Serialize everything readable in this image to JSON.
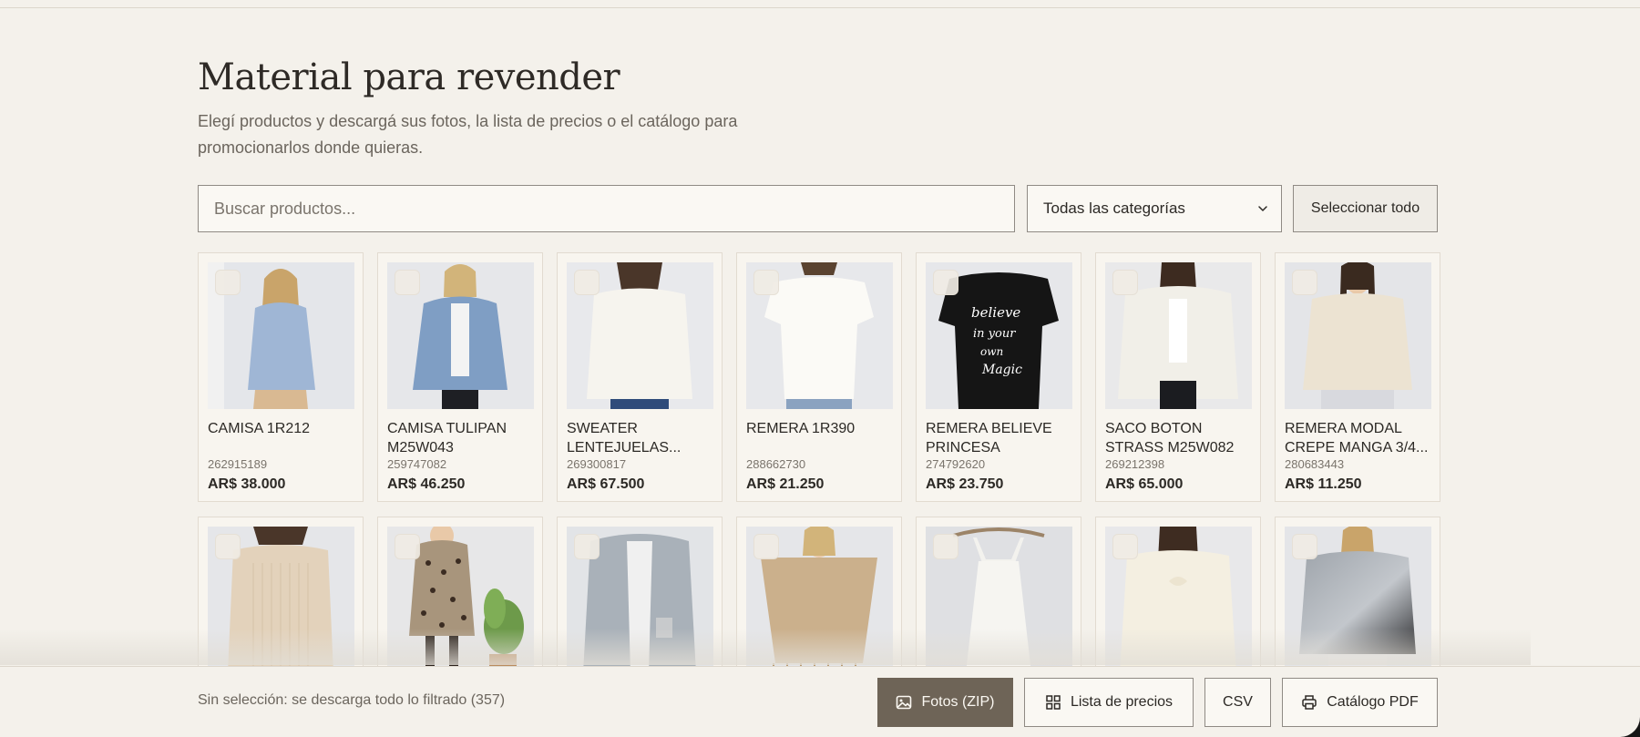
{
  "page": {
    "title": "Material para revender",
    "subtitle": "Elegí productos y descargá sus fotos, la lista de precios o el catálogo para promocionarlos donde quieras."
  },
  "toolbar": {
    "search_placeholder": "Buscar productos...",
    "search_value": "",
    "category_selected": "Todas las categorías",
    "select_all_label": "Seleccionar todo"
  },
  "products": [
    {
      "name": "CAMISA 1R212",
      "sku": "262915189",
      "price": "AR$ 38.000",
      "photo": "blue-shirt"
    },
    {
      "name": "CAMISA TULIPAN M25W043",
      "sku": "259747082",
      "price": "AR$ 46.250",
      "photo": "denim-jacket"
    },
    {
      "name": "SWEATER LENTEJUELAS...",
      "sku": "269300817",
      "price": "AR$ 67.500",
      "photo": "cream-sweater"
    },
    {
      "name": "REMERA 1R390",
      "sku": "288662730",
      "price": "AR$ 21.250",
      "photo": "white-tee"
    },
    {
      "name": "REMERA BELIEVE PRINCESA",
      "sku": "274792620",
      "price": "AR$ 23.750",
      "photo": "black-tee"
    },
    {
      "name": "SACO BOTON STRASS M25W082",
      "sku": "269212398",
      "price": "AR$ 65.000",
      "photo": "white-cardigan"
    },
    {
      "name": "REMERA MODAL CREPE MANGA 3/4...",
      "sku": "280683443",
      "price": "AR$ 11.250",
      "photo": "beige-top"
    },
    {
      "name": "",
      "sku": "",
      "price": "",
      "photo": "beige-knit"
    },
    {
      "name": "",
      "sku": "",
      "price": "",
      "photo": "leopard-dress"
    },
    {
      "name": "",
      "sku": "",
      "price": "",
      "photo": "grey-coat"
    },
    {
      "name": "",
      "sku": "",
      "price": "",
      "photo": "camel-poncho"
    },
    {
      "name": "",
      "sku": "",
      "price": "",
      "photo": "white-slip"
    },
    {
      "name": "",
      "sku": "",
      "price": "",
      "photo": "cream-cable"
    },
    {
      "name": "",
      "sku": "",
      "price": "",
      "photo": "ombre-sweater"
    }
  ],
  "footer": {
    "status": "Sin selección: se descarga todo lo filtrado (357)",
    "photos_label": "Fotos (ZIP)",
    "pricelist_label": "Lista de precios",
    "csv_label": "CSV",
    "catalog_label": "Catálogo PDF"
  },
  "colors": {
    "background": "#f4f1eb",
    "primary_button": "#6e6457",
    "border": "#8f8a84",
    "card_border": "#e2dbd0"
  }
}
